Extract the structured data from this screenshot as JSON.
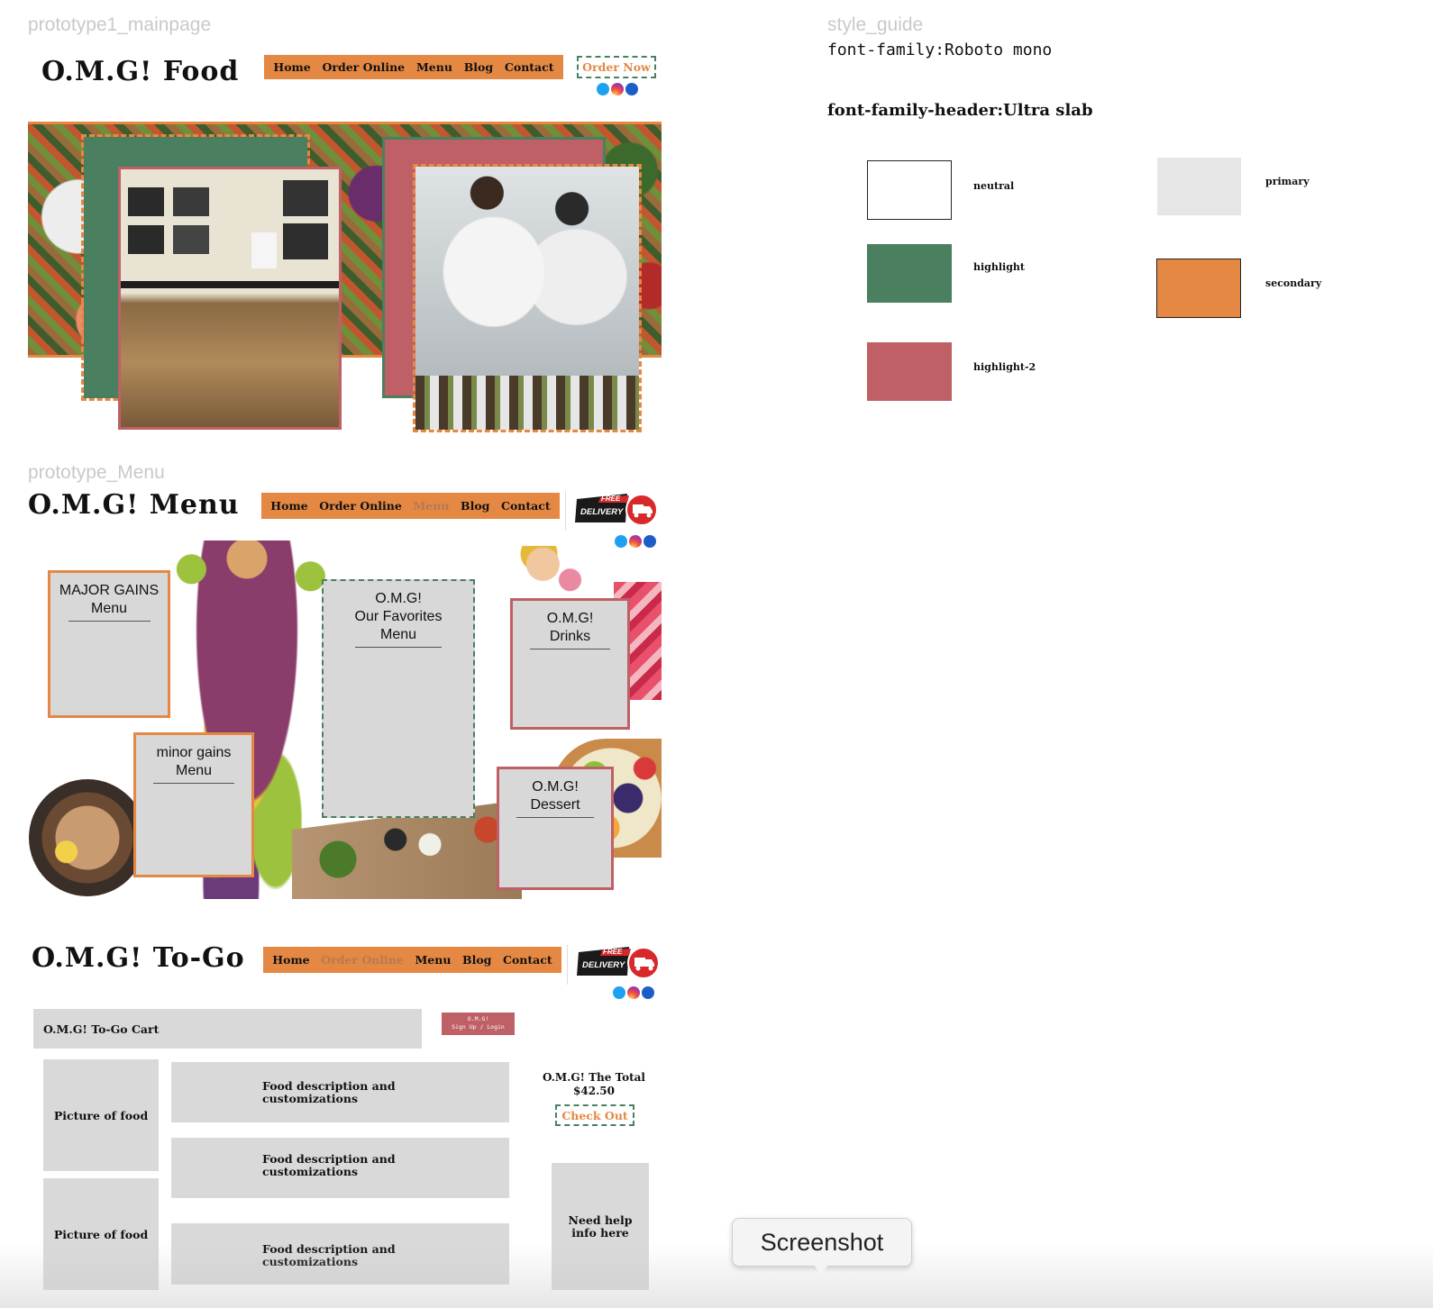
{
  "frames": {
    "main_label": "prototype1_mainpage",
    "menu_label": "prototype_Menu",
    "style_label": "style_guide"
  },
  "nav": {
    "home": "Home",
    "order_online": "Order Online",
    "menu": "Menu",
    "blog": "Blog",
    "contact": "Contact"
  },
  "main": {
    "brand": "O.M.G! Food",
    "order_now": "Order Now"
  },
  "menu_page": {
    "brand": "O.M.G! Menu",
    "cards": {
      "major_1": "MAJOR GAINS",
      "major_2": "Menu",
      "minor_1": "minor gains",
      "minor_2": "Menu",
      "fav_1": "O.M.G!",
      "fav_2": "Our Favorites",
      "fav_3": "Menu",
      "drinks_1": "O.M.G!",
      "drinks_2": "Drinks",
      "dessert_1": "O.M.G!",
      "dessert_2": "Dessert"
    }
  },
  "delivery": {
    "line1": "FREE",
    "line2": "DELIVERY"
  },
  "togo": {
    "brand": "O.M.G! To-Go",
    "cart": "O.M.G! To-Go Cart",
    "signup_1": "O.M.G!",
    "signup_2": "Sign Up / Login",
    "picture": "Picture of food",
    "desc_1": "Food description and",
    "desc_2": "customizations",
    "total_label": "O.M.G! The Total",
    "total_value": "$42.50",
    "checkout": "Check Out",
    "help_1": "Need help",
    "help_2": "info here"
  },
  "style_guide": {
    "font_family": "font-family:Roboto mono",
    "font_header": "font-family-header:Ultra slab",
    "swatches": [
      {
        "label": "neutral",
        "color": "#ffffff"
      },
      {
        "label": "primary",
        "color": "#e6e6e6"
      },
      {
        "label": "highlight",
        "color": "#4a7f60"
      },
      {
        "label": "secondary",
        "color": "#e48843"
      },
      {
        "label": "highlight-2",
        "color": "#be6065"
      }
    ]
  },
  "tooltip": "Screenshot",
  "icons": [
    "twitter-icon",
    "instagram-icon",
    "facebook-icon",
    "delivery-truck-icon"
  ]
}
